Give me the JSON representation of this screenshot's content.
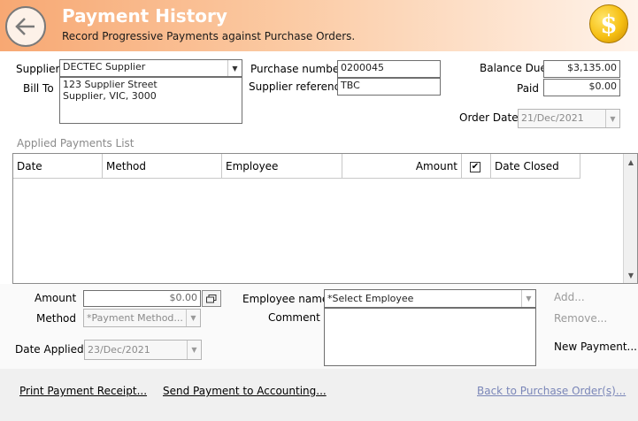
{
  "header": {
    "title": "Payment History",
    "subtitle": "Record Progressive Payments against Purchase Orders."
  },
  "supplier": {
    "label": "Supplier",
    "value": "DECTEC Supplier",
    "bill_to_label": "Bill To",
    "bill_to_line1": "123 Supplier Street",
    "bill_to_line2": "Supplier, VIC, 3000"
  },
  "purchase": {
    "number_label": "Purchase number",
    "number_value": "0200045",
    "reference_label": "Supplier reference",
    "reference_value": "TBC"
  },
  "totals": {
    "balance_due_label": "Balance Due",
    "balance_due_value": "$3,135.00",
    "paid_label": "Paid",
    "paid_value": "$0.00"
  },
  "order_date": {
    "label": "Order Date",
    "value": "21/Dec/2021"
  },
  "payments_list": {
    "caption": "Applied Payments List",
    "columns": [
      "Date",
      "Method",
      "Employee",
      "Amount",
      "",
      "Date Closed"
    ],
    "rows": []
  },
  "entry": {
    "amount_label": "Amount",
    "amount_value": "$0.00",
    "method_label": "Method",
    "method_placeholder": "*Payment Method...",
    "date_applied_label": "Date Applied",
    "date_applied_value": "23/Dec/2021",
    "employee_label": "Employee name",
    "employee_placeholder": "*Select Employee",
    "comment_label": "Comment",
    "comment_value": ""
  },
  "actions": {
    "add": "Add...",
    "remove": "Remove...",
    "new_payment": "New Payment..."
  },
  "footer": {
    "print_receipt": "Print Payment Receipt...",
    "send_accounting": "Send Payment to Accounting...",
    "back_to_po": "Back to Purchase Order(s)..."
  },
  "colors": {
    "header_start": "#f7a873",
    "header_end": "#fff3ea",
    "coin": "#f6bf12",
    "muted_link": "#7a86b8"
  }
}
